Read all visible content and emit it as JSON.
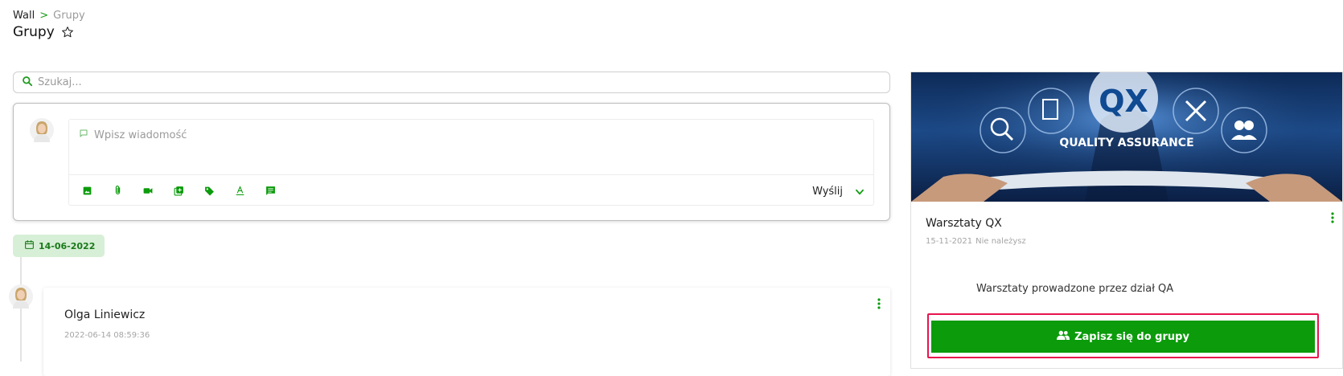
{
  "header": {
    "breadcrumb": {
      "root": "Wall",
      "separator": ">",
      "current": "Grupy"
    },
    "title": "Grupy"
  },
  "search": {
    "placeholder": "Szukaj...",
    "value": ""
  },
  "composer": {
    "placeholder": "Wpisz wiadomość",
    "tools": [
      "image-icon",
      "attachment-icon",
      "video-icon",
      "add-box-icon",
      "tag-icon",
      "text-format-icon",
      "comment-icon"
    ],
    "send_label": "Wyślij"
  },
  "timeline": {
    "date_badge": "14-06-2022",
    "post": {
      "author": "Olga Liniewicz",
      "timestamp": "2022-06-14 08:59:36"
    }
  },
  "group": {
    "banner_title": "QX",
    "banner_subtitle": "QUALITY ASSURANCE",
    "name": "Warsztaty QX",
    "date": "15-11-2021",
    "membership": "Nie należysz",
    "description": "Warsztaty prowadzone przez dział QA",
    "join_label": "Zapisz się do grupy"
  },
  "colors": {
    "accent": "#0b9b0b",
    "highlight": "#e8144e",
    "badge_bg": "#d7efd7"
  }
}
